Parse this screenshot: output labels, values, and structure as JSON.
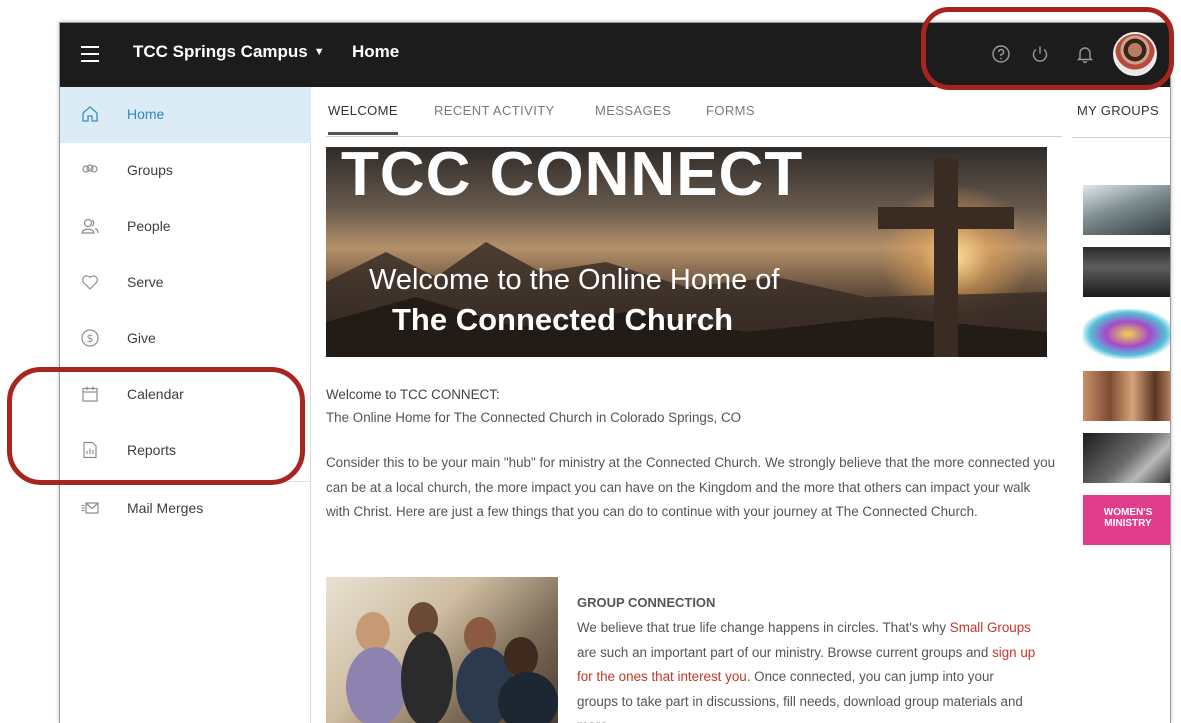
{
  "topbar": {
    "campus": "TCC Springs Campus",
    "breadcrumb": "Home"
  },
  "sidebar": {
    "items": [
      {
        "label": "Home",
        "icon": "home-icon",
        "active": true
      },
      {
        "label": "Groups",
        "icon": "groups-icon"
      },
      {
        "label": "People",
        "icon": "people-icon"
      },
      {
        "label": "Serve",
        "icon": "heart-icon"
      },
      {
        "label": "Give",
        "icon": "dollar-icon"
      },
      {
        "label": "Calendar",
        "icon": "calendar-icon"
      },
      {
        "label": "Reports",
        "icon": "report-icon"
      },
      {
        "label": "Mail Merges",
        "icon": "mail-merge-icon"
      }
    ]
  },
  "tabs": [
    "WELCOME",
    "RECENT ACTIVITY",
    "MESSAGES",
    "FORMS"
  ],
  "hero": {
    "title": "TCC CONNECT",
    "line1": "Welcome to the Online Home of",
    "line2": "The Connected Church"
  },
  "intro": {
    "title": "Welcome to TCC CONNECT:",
    "subtitle": "The Online Home for The Connected Church in Colorado Springs, CO",
    "paragraph": "Consider this to be your main \"hub\" for ministry at the Connected Church. We strongly believe that the more connected you can be at a local church, the more impact you can have on the Kingdom and the more that others can impact your walk with Christ. Here are just a few things that you can do to continue with your journey at The Connected Church."
  },
  "group_connection": {
    "title": "GROUP CONNECTION",
    "text1": "We believe that true life change happens in circles. That's why",
    "link1": "Small Groups",
    "text2": " are such an important part of our ministry. Browse current groups and ",
    "link2": "sign up for the ones that interest you",
    "text3": ". Once connected, you can jump into your groups to take part in discussions, fill needs, download group materials and more."
  },
  "my_groups": {
    "title": "MY GROUPS",
    "thumb_text": "WOMEN'S MINISTRY"
  },
  "colors": {
    "topbar": "#1c1c1c",
    "active_nav": "#dcecf7",
    "link": "#c0392b",
    "annotation": "#a8241e"
  }
}
